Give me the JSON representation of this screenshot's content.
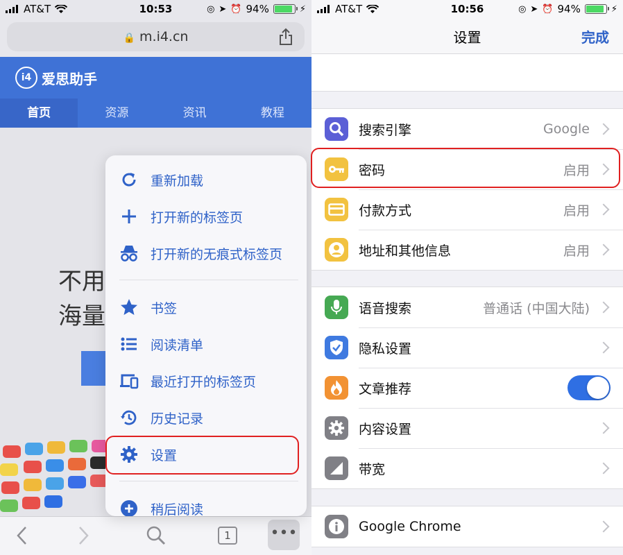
{
  "left": {
    "status": {
      "carrier": "AT&T",
      "time": "10:53",
      "battery": "94%"
    },
    "url": "m.i4.cn",
    "site": {
      "logo": "爱思助手",
      "logo_mark": "i4",
      "nav": [
        "首页",
        "资源",
        "资讯",
        "教程"
      ],
      "hero_line1": "不用越狱",
      "hero_line2": "海量应用"
    },
    "menu": {
      "items": [
        {
          "label": "重新加载",
          "icon": "reload-icon"
        },
        {
          "label": "打开新的标签页",
          "icon": "plus-icon"
        },
        {
          "label": "打开新的无痕式标签页",
          "icon": "incognito-icon"
        },
        {
          "label": "书签",
          "icon": "star-icon"
        },
        {
          "label": "阅读清单",
          "icon": "list-icon"
        },
        {
          "label": "最近打开的标签页",
          "icon": "devices-icon"
        },
        {
          "label": "历史记录",
          "icon": "history-icon"
        },
        {
          "label": "设置",
          "icon": "gear-icon"
        },
        {
          "label": "稍后阅读",
          "icon": "add-circle-icon"
        }
      ]
    },
    "toolbar": {
      "tab_count": "1"
    }
  },
  "right": {
    "status": {
      "carrier": "AT&T",
      "time": "10:56",
      "battery": "94%"
    },
    "title": "设置",
    "done": "完成",
    "group1": [
      {
        "label": "搜索引擎",
        "value": "Google",
        "icon": "search-icon",
        "color": "#5b5fd6"
      },
      {
        "label": "密码",
        "value": "启用",
        "icon": "key-icon",
        "color": "#f2c240"
      },
      {
        "label": "付款方式",
        "value": "启用",
        "icon": "card-icon",
        "color": "#f2c240"
      },
      {
        "label": "地址和其他信息",
        "value": "启用",
        "icon": "person-icon",
        "color": "#f2c240"
      }
    ],
    "group2": [
      {
        "label": "语音搜索",
        "value": "普通话 (中国大陆)",
        "icon": "mic-icon",
        "color": "#46a953"
      },
      {
        "label": "隐私设置",
        "value": "",
        "icon": "shield-icon",
        "color": "#3f7ae0"
      },
      {
        "label": "文章推荐",
        "value": "",
        "icon": "flame-icon",
        "color": "#f29233",
        "toggle": true
      },
      {
        "label": "内容设置",
        "value": "",
        "icon": "gear-icon",
        "color": "#808086"
      },
      {
        "label": "带宽",
        "value": "",
        "icon": "bandwidth-icon",
        "color": "#808086"
      }
    ],
    "group3": [
      {
        "label": "Google Chrome",
        "value": "",
        "icon": "info-icon",
        "color": "#808086"
      }
    ]
  }
}
